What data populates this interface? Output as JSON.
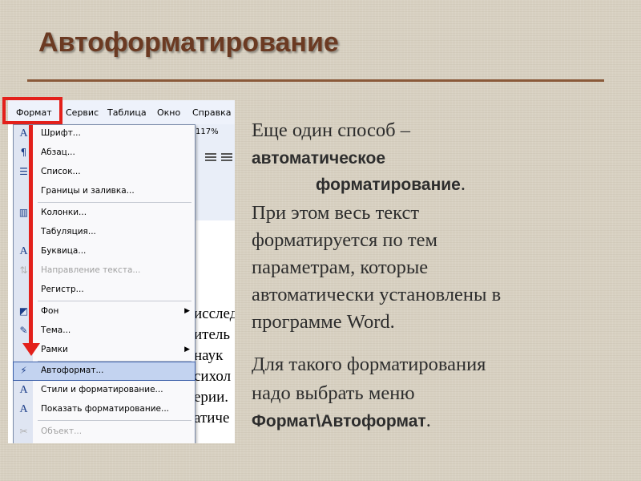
{
  "slide": {
    "title": "Автоформатирование",
    "para1": {
      "line1": "Еще один способ –",
      "line2": "автоматическое",
      "line3": "форматирование",
      "line3_end": ".",
      "line4": "При этом весь текст",
      "line5": "форматируется по тем",
      "line6": "параметрам, которые",
      "line7": "автоматически установлены в",
      "line8": "программе Word."
    },
    "para2": {
      "line1": "Для такого форматирования",
      "line2": "надо выбрать меню",
      "line3": "Формат\\Автоформат",
      "line3_end": "."
    },
    "colors": {
      "title": "#6b3a22",
      "accent_red": "#e3201b",
      "rule": "#8a5a3a"
    }
  },
  "word": {
    "menubar": [
      "Формат",
      "Сервис",
      "Таблица",
      "Окно",
      "Справка"
    ],
    "zoom": "117%",
    "doc_fragments": [
      "исслед",
      "итель",
      "наук",
      "сихол",
      "ерии.",
      "атиче"
    ],
    "menu": [
      {
        "label": "Шрифт...",
        "icon": "font-icon",
        "glyph": "A"
      },
      {
        "label": "Абзац...",
        "icon": "paragraph-icon",
        "glyph": "¶"
      },
      {
        "label": "Список...",
        "icon": "list-icon",
        "glyph": "☰"
      },
      {
        "label": "Границы и заливка...",
        "icon": "",
        "glyph": ""
      },
      {
        "label": "Колонки...",
        "icon": "columns-icon",
        "glyph": "▥"
      },
      {
        "label": "Табуляция...",
        "icon": "",
        "glyph": ""
      },
      {
        "label": "Буквица...",
        "icon": "drop-cap-icon",
        "glyph": "A"
      },
      {
        "label": "Направление текста...",
        "icon": "text-direction-icon",
        "glyph": "⇅"
      },
      {
        "label": "Регистр...",
        "icon": "",
        "glyph": ""
      },
      {
        "label": "Фон",
        "icon": "background-icon",
        "glyph": "◩"
      },
      {
        "label": "Тема...",
        "icon": "theme-icon",
        "glyph": "✎"
      },
      {
        "label": "Рамки",
        "icon": "",
        "glyph": ""
      },
      {
        "label": "Автоформат...",
        "icon": "autoformat-icon",
        "glyph": "⚡"
      },
      {
        "label": "Стили и форматирование...",
        "icon": "styles-icon",
        "glyph": "A"
      },
      {
        "label": "Показать форматирование...",
        "icon": "reveal-formatting-icon",
        "glyph": "A"
      },
      {
        "label": "Объект...",
        "icon": "object-icon",
        "glyph": "✂"
      }
    ]
  }
}
